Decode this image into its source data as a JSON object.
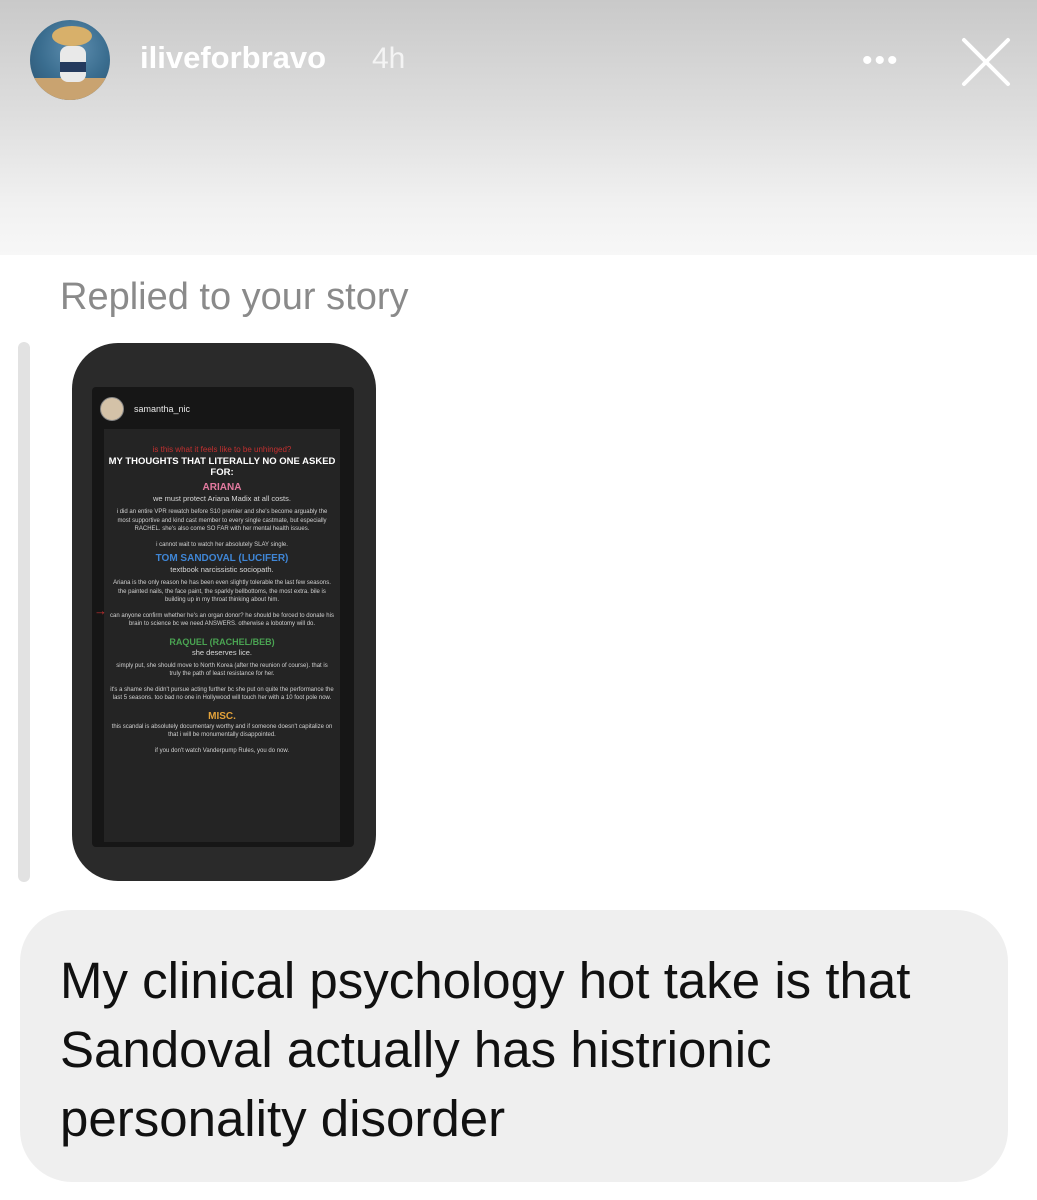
{
  "header": {
    "username": "iliveforbravo",
    "time": "4h",
    "more_label": "•••",
    "close_icon": "close-icon",
    "avatar_icon": "profile-avatar"
  },
  "reply": {
    "label": "Replied to your story"
  },
  "story": {
    "username": "samantha_nic",
    "title_red": "is this what it feels like to be unhinged?",
    "title_white": "MY THOUGHTS THAT LITERALLY NO ONE ASKED FOR:",
    "ariana": {
      "heading": "ARIANA",
      "sub": "we must protect Ariana Madix at all costs.",
      "p1": "i did an entire VPR rewatch before S10 premier and she's become arguably the most supportive and kind cast member to every single castmate, but especially RACHEL. she's also come SO FAR with her mental health issues.",
      "p2": "i cannot wait to watch her absolutely SLAY single."
    },
    "tom": {
      "heading": "TOM SANDOVAL (LUCIFER)",
      "sub": "textbook narcissistic sociopath.",
      "p1": "Ariana is the only reason he has been even slightly tolerable the last few seasons. the painted nails, the face paint, the sparkly bellbottoms, the most extra. bile is building up in my throat thinking about him.",
      "p2": "can anyone confirm whether he's an organ donor? he should be forced to donate his brain to science bc we need ANSWERS. otherwise a lobotomy will do."
    },
    "raquel": {
      "heading": "RAQUEL (RACHEL/BEB)",
      "sub": "she deserves lice.",
      "p1": "simply put, she should move to North Korea (after the reunion of course). that is truly the path of least resistance for her.",
      "p2": "it's a shame she didn't pursue acting further bc she put on quite the performance the last 5 seasons. too bad no one in Hollywood will touch her with a 10 foot pole now."
    },
    "misc": {
      "heading": "MISC.",
      "p1": "this scandal is absolutely documentary worthy and if someone doesn't capitalize on that i will be monumentally disappointed.",
      "p2": "if you don't watch Vanderpump Rules, you do now."
    }
  },
  "message": {
    "text": "My clinical psychology hot take is that Sandoval actually has histrionic personality disorder"
  }
}
